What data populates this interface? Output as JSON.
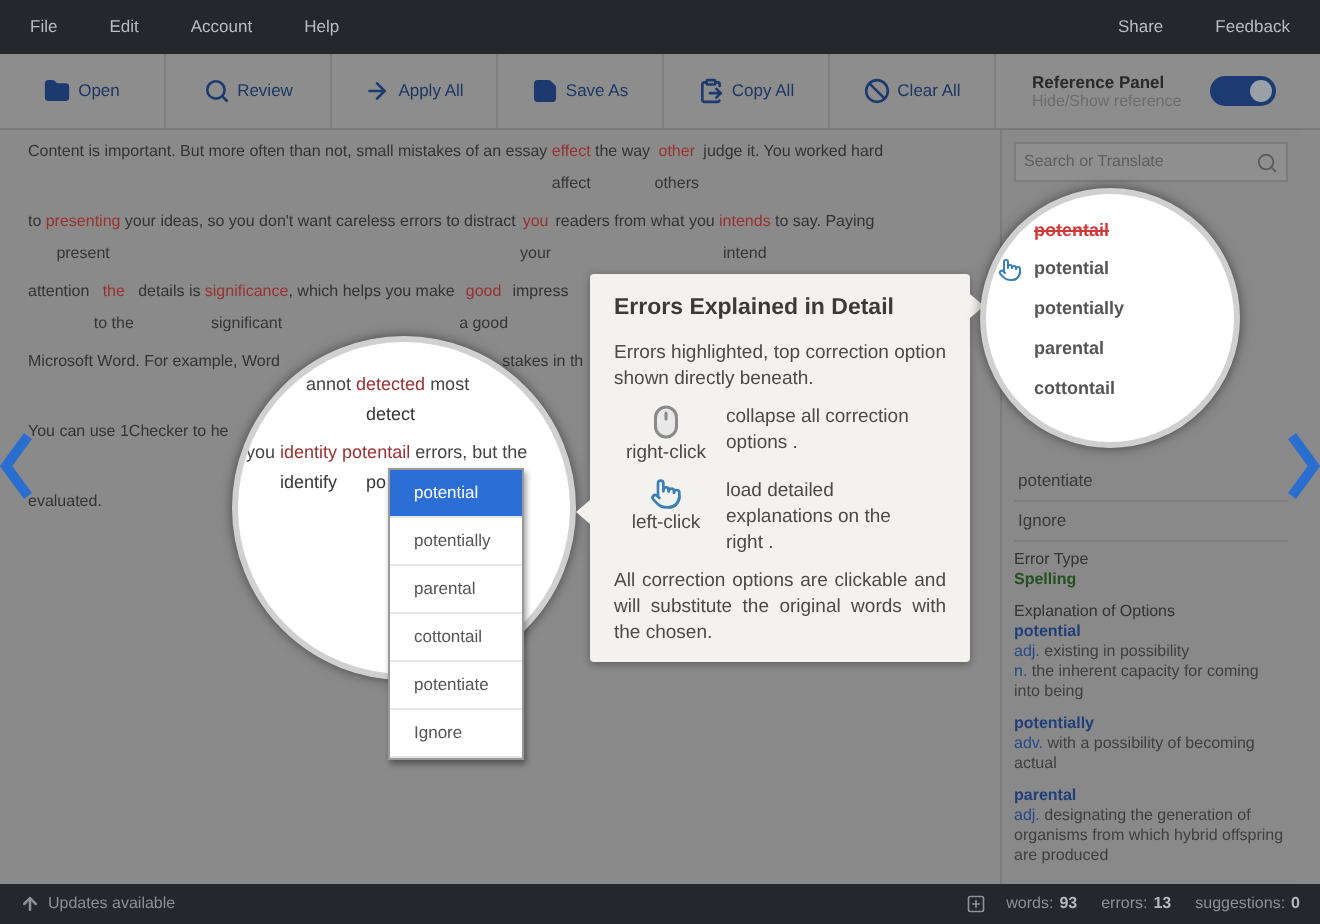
{
  "menu": {
    "left": [
      "File",
      "Edit",
      "Account",
      "Help"
    ],
    "right": [
      "Share",
      "Feedback"
    ]
  },
  "toolbar": {
    "buttons": [
      {
        "kind": "open",
        "label": "Open"
      },
      {
        "kind": "review",
        "label": "Review"
      },
      {
        "kind": "apply",
        "label": "Apply All"
      },
      {
        "kind": "save",
        "label": "Save As"
      },
      {
        "kind": "copy",
        "label": "Copy All"
      },
      {
        "kind": "clear",
        "label": "Clear All"
      }
    ],
    "reference_panel": {
      "title": "Reference Panel",
      "subtitle": "Hide/Show reference",
      "on": true
    }
  },
  "editor": {
    "lines": [
      {
        "segments": [
          {
            "text": "Content is important. But more often than not, small mistakes of an essay"
          },
          {
            "text": "effect",
            "fix": "affect"
          },
          {
            "text": "the way"
          },
          {
            "text": "other",
            "fix": "others"
          },
          {
            "text": "judge it. You worked hard"
          }
        ]
      },
      {
        "segments": [
          {
            "text": "to"
          },
          {
            "text": "presenting",
            "fix": "present"
          },
          {
            "text": "your ideas, so you don't want careless errors to distract"
          },
          {
            "text": "you",
            "fix": "your"
          },
          {
            "text": "readers from what you"
          },
          {
            "text": "intends",
            "fix": "intend"
          },
          {
            "text": "to say. Paying"
          }
        ]
      },
      {
        "segments": [
          {
            "text": "attention"
          },
          {
            "text": "the",
            "fix": "to the"
          },
          {
            "text": "details is"
          },
          {
            "text": "significance",
            "fix": "significant"
          },
          {
            "text": ", which helps you make",
            "attach": true
          },
          {
            "text": "good",
            "fix": "a good"
          },
          {
            "text": "impress"
          }
        ]
      },
      {
        "segments": [
          {
            "text": "Microsoft Word. For example, Word"
          }
        ],
        "tail": "stakes in th"
      },
      {
        "segments": [
          {
            "text": "You can use 1Checker to he"
          }
        ]
      },
      {
        "segments": [
          {
            "text": "evaluated."
          }
        ]
      }
    ]
  },
  "left_magnifier": {
    "lines": [
      {
        "segments": [
          {
            "text": "annot"
          },
          {
            "text": "detected",
            "fix": "detect"
          },
          {
            "text": "most"
          }
        ]
      },
      {
        "segments": [
          {
            "text": "you"
          },
          {
            "text": "identity",
            "fix": "identify"
          },
          {
            "text": "potentail",
            "fix": "po"
          },
          {
            "text": "errors, but the"
          }
        ]
      }
    ],
    "dropdown": [
      {
        "label": "potential",
        "selected": true
      },
      {
        "label": "potentially",
        "selected": false
      },
      {
        "label": "parental",
        "selected": false
      },
      {
        "label": "cottontail",
        "selected": false
      },
      {
        "label": "potentiate",
        "selected": false
      },
      {
        "label": "Ignore",
        "selected": false
      }
    ]
  },
  "tooltip": {
    "title": "Errors Explained in Detail",
    "intro": "Errors highlighted, top correction option shown directly beneath.",
    "tips": [
      {
        "kind": "mouse",
        "action": "right-click",
        "text": "collapse all correction options ."
      },
      {
        "kind": "hand",
        "action": "left-click",
        "text": "load detailed explanations on the right ."
      }
    ],
    "outro": "All correction options are clickable and will substitute the original words with the chosen."
  },
  "reference": {
    "search_placeholder": "Search or Translate",
    "magnifier": {
      "original": "potentail",
      "options": [
        {
          "label": "potential",
          "pointed": true
        },
        {
          "label": "potentially",
          "pointed": false
        },
        {
          "label": "parental",
          "pointed": false
        },
        {
          "label": "cottontail",
          "pointed": false
        }
      ]
    },
    "options": [
      "potentiate",
      "Ignore"
    ],
    "error_type_label": "Error Type",
    "error_type": "Spelling",
    "explanation_title": "Explanation of Options",
    "explanations": [
      {
        "word": "potential",
        "senses": [
          {
            "pos": "adj.",
            "text": "existing in possibility"
          },
          {
            "pos": "n.",
            "text": "the inherent capacity for coming into being"
          }
        ]
      },
      {
        "word": "potentially",
        "senses": [
          {
            "pos": "adv.",
            "text": "with a possibility of becoming actual"
          }
        ]
      },
      {
        "word": "parental",
        "senses": [
          {
            "pos": "adj.",
            "text": "designating the generation of organisms from which hybrid offspring are produced"
          }
        ]
      }
    ]
  },
  "status": {
    "update": "Updates available",
    "stats": [
      {
        "label": "words:",
        "value": "93"
      },
      {
        "label": "errors:",
        "value": "13"
      },
      {
        "label": "suggestions:",
        "value": "0"
      }
    ]
  }
}
